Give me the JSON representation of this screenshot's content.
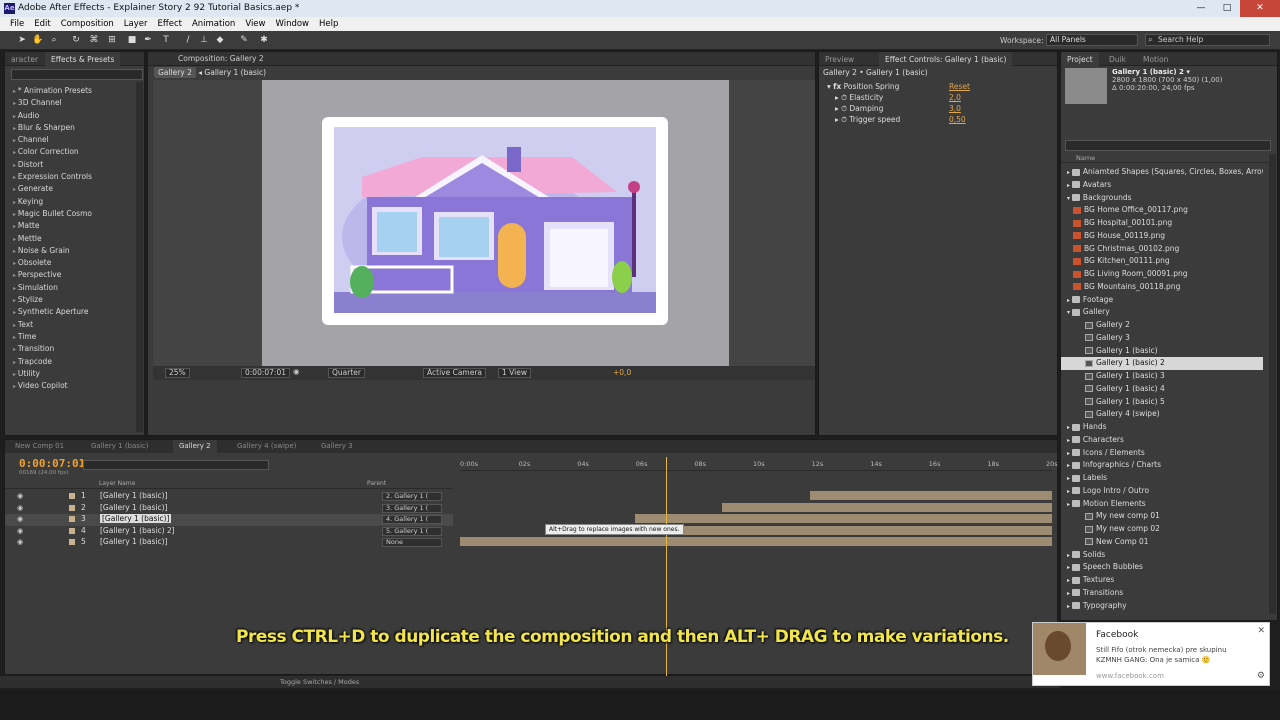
{
  "window": {
    "title": "Adobe After Effects - Explainer Story 2 92 Tutorial Basics.aep *",
    "app_icon": "Ae"
  },
  "menu": [
    "File",
    "Edit",
    "Composition",
    "Layer",
    "Effect",
    "Animation",
    "View",
    "Window",
    "Help"
  ],
  "toolbar": {
    "workspace_label": "Workspace:",
    "workspace_value": "All Panels",
    "search_placeholder": "Search Help"
  },
  "effects_panel": {
    "tabs": [
      "aracter",
      "Effects & Presets"
    ],
    "items": [
      "* Animation Presets",
      "3D Channel",
      "Audio",
      "Blur & Sharpen",
      "Channel",
      "Color Correction",
      "Distort",
      "Expression Controls",
      "Generate",
      "Keying",
      "Magic Bullet Cosmo",
      "Matte",
      "Mettle",
      "Noise & Grain",
      "Obsolete",
      "Perspective",
      "Simulation",
      "Stylize",
      "Synthetic Aperture",
      "Text",
      "Time",
      "Transition",
      "Trapcode",
      "Utility",
      "Video Copilot"
    ]
  },
  "composition_panel": {
    "tab_label": "Composition: Gallery 2",
    "breadcrumb_active": "Gallery 2",
    "breadcrumb_next": "Gallery 1 (basic)",
    "zoom": "25%",
    "timecode": "0:00:07:01",
    "resolution": "Quarter",
    "camera": "Active Camera",
    "views": "1 View",
    "exposure": "+0,0"
  },
  "effect_controls": {
    "tabs": [
      "Preview",
      "Effect Controls: Gallery 1 (basic)"
    ],
    "title": "Gallery 2 • Gallery 1 (basic)",
    "effect_name": "Position Spring",
    "reset_label": "Reset",
    "params": [
      {
        "name": "Elasticity",
        "value": "2,0"
      },
      {
        "name": "Damping",
        "value": "3,0"
      },
      {
        "name": "Trigger speed",
        "value": "0,50"
      }
    ]
  },
  "project_panel": {
    "tabs": [
      "Project",
      "Duik",
      "Motion"
    ],
    "selected_name": "Gallery 1 (basic) 2 ▾",
    "selected_dims": "2800 x 1800  (700 x 450) (1,00)",
    "selected_duration": "Δ 0:00:20:00, 24,00 fps",
    "name_header": "Name",
    "items": [
      {
        "type": "folder",
        "name": "Aniamted Shapes (Squares, Circles, Boxes, Arrows, etc)",
        "expanded": false
      },
      {
        "type": "folder",
        "name": "Avatars",
        "expanded": false
      },
      {
        "type": "folder",
        "name": "Backgrounds",
        "expanded": true
      },
      {
        "type": "png",
        "name": "BG Home Office_00117.png"
      },
      {
        "type": "png",
        "name": "BG Hospital_00101.png"
      },
      {
        "type": "png",
        "name": "BG House_00119.png"
      },
      {
        "type": "png",
        "name": "BG Christmas_00102.png"
      },
      {
        "type": "png",
        "name": "BG Kitchen_00111.png"
      },
      {
        "type": "png",
        "name": "BG Living Room_00091.png"
      },
      {
        "type": "png",
        "name": "BG Mountains_00118.png"
      },
      {
        "type": "folder",
        "name": "Footage",
        "expanded": false
      },
      {
        "type": "folder",
        "name": "Gallery",
        "expanded": true
      },
      {
        "type": "comp",
        "name": "Gallery 2"
      },
      {
        "type": "comp",
        "name": "Gallery 3"
      },
      {
        "type": "comp",
        "name": "Gallery 1 (basic)"
      },
      {
        "type": "comp",
        "name": "Gallery 1 (basic) 2",
        "selected": true
      },
      {
        "type": "comp",
        "name": "Gallery 1 (basic) 3"
      },
      {
        "type": "comp",
        "name": "Gallery 1 (basic) 4"
      },
      {
        "type": "comp",
        "name": "Gallery 1 (basic) 5"
      },
      {
        "type": "comp",
        "name": "Gallery 4 (swipe)"
      },
      {
        "type": "folder",
        "name": "Hands",
        "expanded": false
      },
      {
        "type": "folder",
        "name": "Characters",
        "expanded": false
      },
      {
        "type": "folder",
        "name": "Icons / Elements",
        "expanded": false
      },
      {
        "type": "folder",
        "name": "Infographics / Charts",
        "expanded": false
      },
      {
        "type": "folder",
        "name": "Labels",
        "expanded": false
      },
      {
        "type": "folder",
        "name": "Logo Intro / Outro",
        "expanded": false
      },
      {
        "type": "folder",
        "name": "Motion Elements",
        "expanded": false
      },
      {
        "type": "comp",
        "name": "My new comp 01"
      },
      {
        "type": "comp",
        "name": "My new comp 02"
      },
      {
        "type": "comp",
        "name": "New Comp 01"
      },
      {
        "type": "folder",
        "name": "Solids",
        "expanded": false
      },
      {
        "type": "folder",
        "name": "Speech Bubbles",
        "expanded": false
      },
      {
        "type": "folder",
        "name": "Textures",
        "expanded": false
      },
      {
        "type": "folder",
        "name": "Transitions",
        "expanded": false
      },
      {
        "type": "folder",
        "name": "Typography",
        "expanded": false
      }
    ]
  },
  "timeline": {
    "tabs": [
      "New Comp 01",
      "Gallery 1 (basic)",
      "Gallery 2",
      "Gallery 4 (swipe)",
      "Gallery 3"
    ],
    "active_tab": "Gallery 2",
    "timecode": "0:00:07:01",
    "fps": "00169 (24.00 fps)",
    "layer_name_header": "Layer Name",
    "parent_header": "Parent",
    "ruler": [
      "0:00s",
      "02s",
      "04s",
      "06s",
      "08s",
      "10s",
      "12s",
      "14s",
      "16s",
      "18s",
      "20s"
    ],
    "layers": [
      {
        "num": "1",
        "name": "[Gallery 1 (basic)]",
        "parent": "2. Gallery 1 ("
      },
      {
        "num": "2",
        "name": "[Gallery 1 (basic)]",
        "parent": "3. Gallery 1 ("
      },
      {
        "num": "3",
        "name": "[Gallery 1 (basic)]",
        "parent": "4. Gallery 1 ("
      },
      {
        "num": "4",
        "name": "[Gallery 1 (basic) 2]",
        "parent": "5. Gallery 1 ("
      },
      {
        "num": "5",
        "name": "[Gallery 1 (basic)]",
        "parent": "None"
      }
    ],
    "tooltip": "Alt+Drag to replace images with new ones.",
    "toggle_label": "Toggle Switches / Modes"
  },
  "subtitle": "Press CTRL+D to duplicate the composition and then ALT+ DRAG to make variations.",
  "notification": {
    "title": "Facebook",
    "line1": "Still Fifo (otrok nemecka) pre skupinu",
    "line2": "KZMNH GANG: Ona je samica 🙂",
    "url": "www.facebook.com"
  }
}
